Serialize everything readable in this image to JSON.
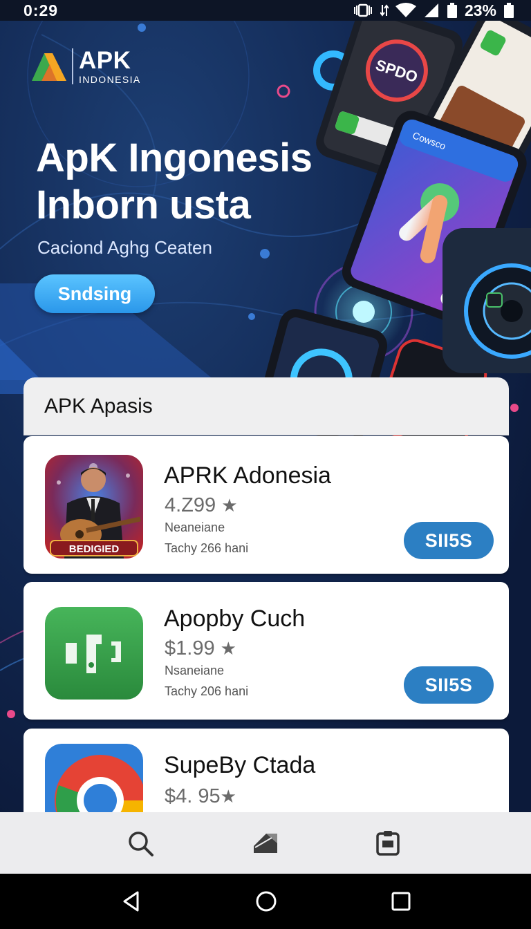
{
  "status_bar": {
    "time": "0:29",
    "battery": "23%"
  },
  "hero": {
    "logo": {
      "brand": "APK",
      "sub": "INDONESIA"
    },
    "title_line1": "ApK Ingonesis",
    "title_line2": "Inborn usta",
    "subtitle": "Caciond Aghg Ceaten",
    "button_label": "Sndsing",
    "phone_badge": "SPDO",
    "phone_label": "Cowsco"
  },
  "list": {
    "title": "APK Apasis",
    "apps": [
      {
        "name": "APRK Adonesia",
        "price": "4.Z99",
        "meta1": "Neaneiane",
        "meta2": "Tachy 266 hani",
        "button": "SII5S",
        "icon_caption": "BEDIGIED"
      },
      {
        "name": "Apopby Cuch",
        "price": "$1.99",
        "meta1": "Nsaneiane",
        "meta2": "Tachy 206 hani",
        "button": "SII5S"
      },
      {
        "name": "SupeBy Ctada",
        "price": "$4. 95"
      }
    ],
    "star_glyph": "★"
  },
  "bottom_nav": {
    "items": [
      "search-icon",
      "tag-icon",
      "clipboard-icon"
    ]
  },
  "system_nav": {
    "items": [
      "back-icon",
      "home-icon",
      "recents-icon"
    ]
  },
  "colors": {
    "accent": "#2c7fc3",
    "hero_button": "#3aa6f0",
    "background": "#0c1a3a"
  }
}
